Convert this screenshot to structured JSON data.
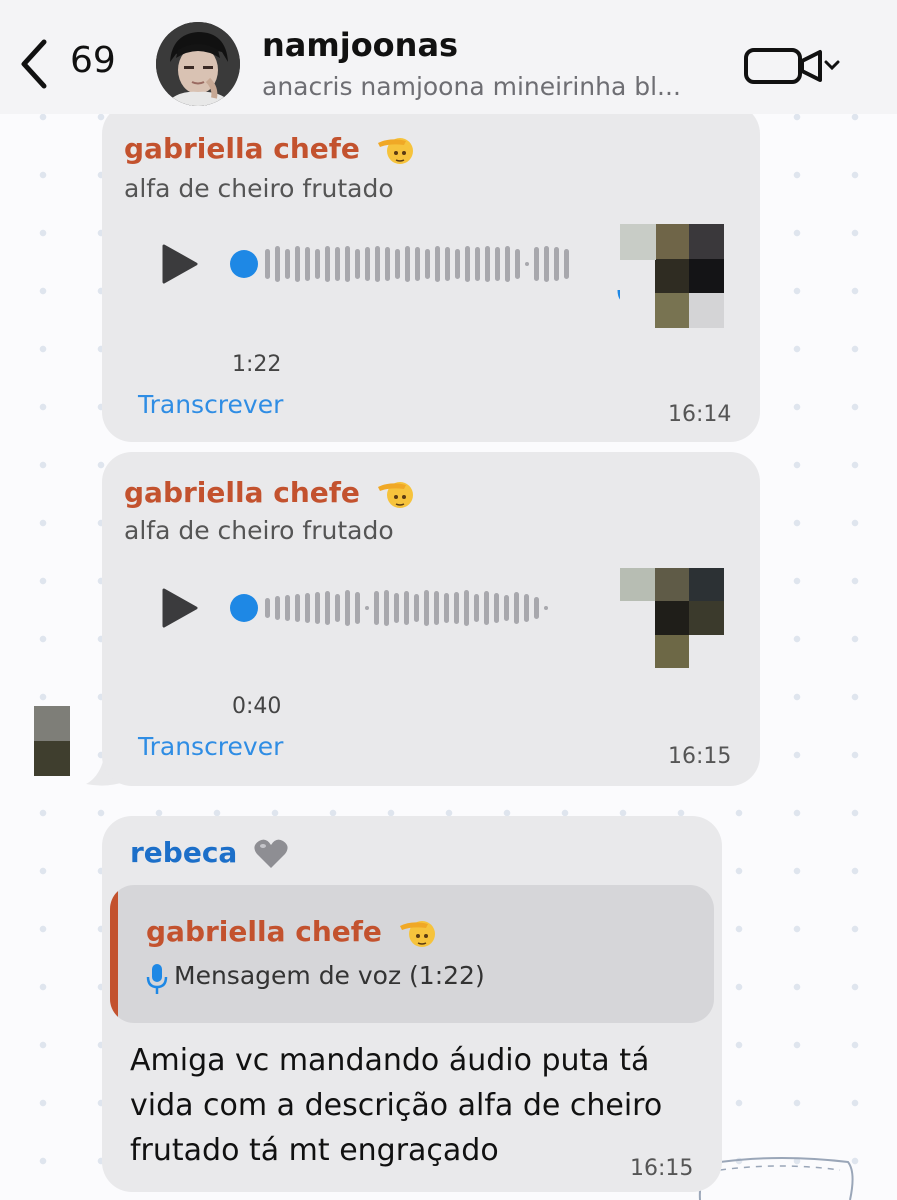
{
  "header": {
    "back_count": "69",
    "title": "namjoonas",
    "subtitle": "anacris namjoona mineirinha bl..."
  },
  "messages": [
    {
      "sender": "gabriella chefe",
      "caption": "alfa de cheiro frutado",
      "duration": "1:22",
      "transcribe_label": "Transcrever",
      "time": "16:14"
    },
    {
      "sender": "gabriella chefe",
      "caption": "alfa de cheiro frutado",
      "duration": "0:40",
      "transcribe_label": "Transcrever",
      "time": "16:15"
    },
    {
      "sender": "rebeca",
      "reply": {
        "sender": "gabriella chefe",
        "text": "Mensagem de voz (1:22)"
      },
      "text": "Amiga vc mandando áudio puta tá vida com a descrição alfa de cheiro frutado tá mt engraçado",
      "time": "16:15"
    }
  ],
  "colors": {
    "sender_orange": "#c3522e",
    "sender_blue": "#1c6fc9",
    "link_blue": "#2f8de4",
    "bubble_gray": "#e9e9eb"
  },
  "icons": [
    "chevron-left-icon",
    "video-camera-icon",
    "chevron-down-icon",
    "play-icon",
    "microphone-icon",
    "saluting-face-emoji",
    "grey-heart-emoji"
  ]
}
